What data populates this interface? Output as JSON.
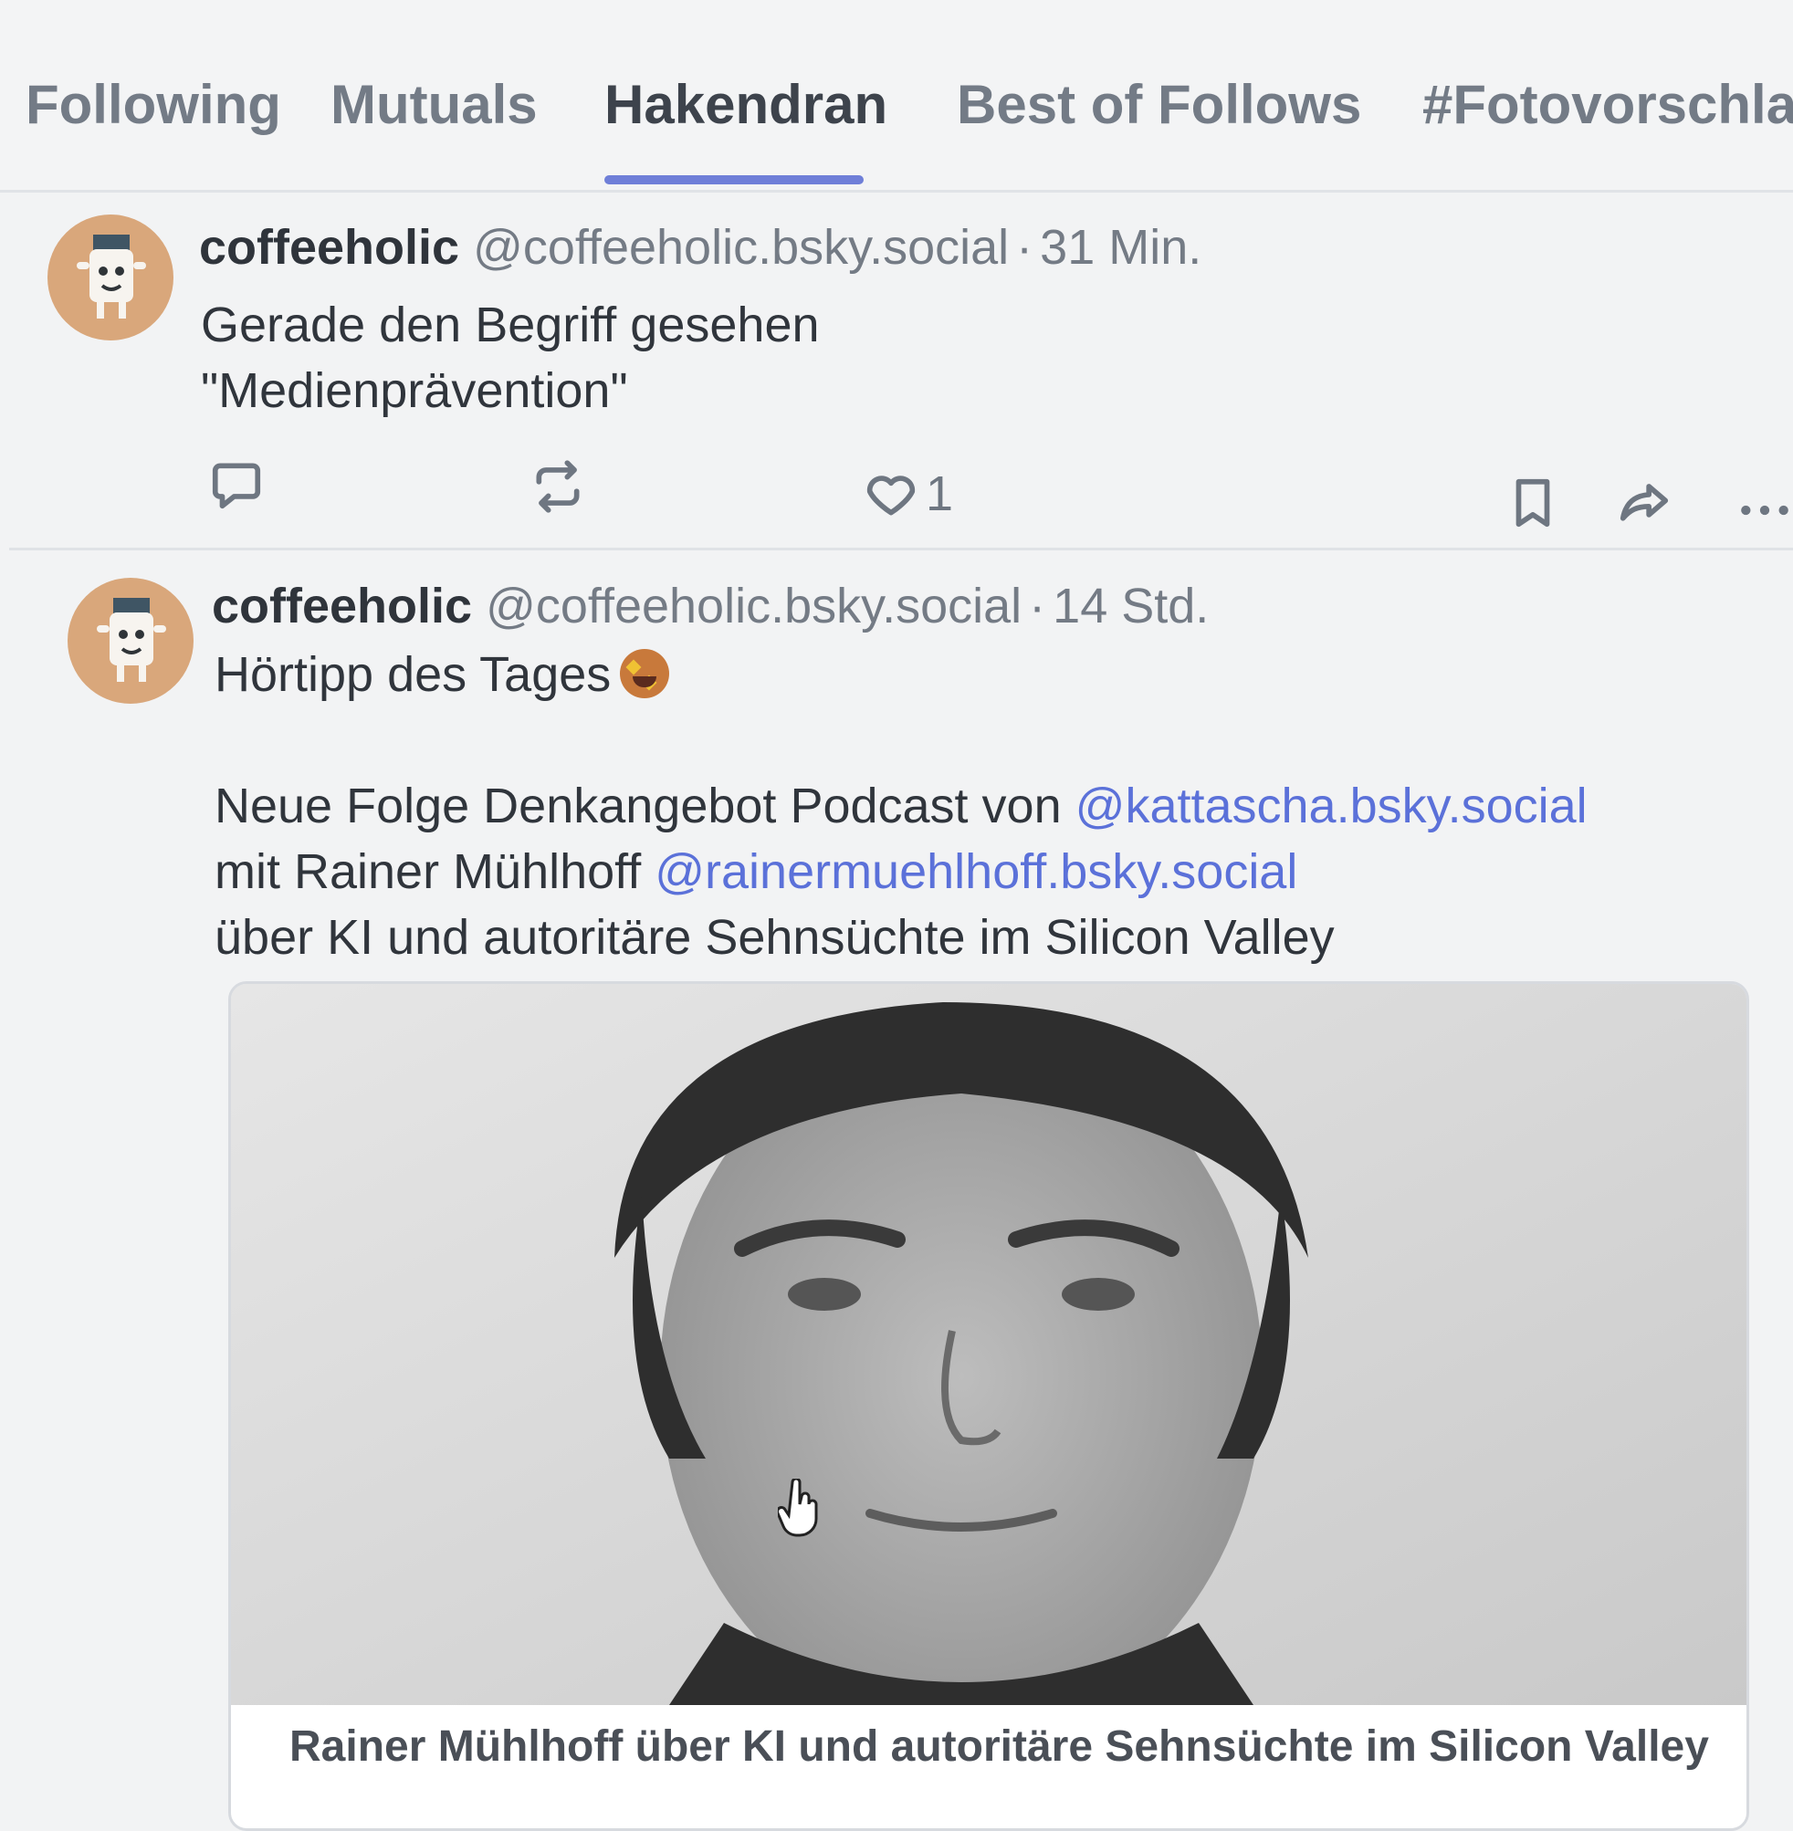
{
  "tabs": [
    {
      "label": "Following",
      "active": false
    },
    {
      "label": "Mutuals",
      "active": false
    },
    {
      "label": "Hakendran",
      "active": true
    },
    {
      "label": "Best of Follows",
      "active": false
    },
    {
      "label": "#Fotovorschla",
      "active": false
    }
  ],
  "posts": [
    {
      "display_name": "coffeeholic",
      "handle": "@coffeeholic.bsky.social",
      "separator": "·",
      "time": "31 Min.",
      "lines": [
        "Gerade den Begriff gesehen",
        "\"Medienprävention\""
      ],
      "like_count": "1"
    },
    {
      "display_name": "coffeeholic",
      "handle": "@coffeeholic.bsky.social",
      "separator": "·",
      "time": "14 Std.",
      "headline": "Hörtipp des Tages",
      "body_line1_prefix": "Neue Folge Denkangebot Podcast von ",
      "body_line1_mention": "@kattascha.bsky.social",
      "body_line2_prefix": "mit Rainer Mühlhoff ",
      "body_line2_mention": "@rainermuehlhoff.bsky.social",
      "body_line3": "über KI und autoritäre Sehnsüchte im Silicon Valley",
      "card_title": "Rainer Mühlhoff über KI und autoritäre Sehnsüchte im Silicon Valley"
    }
  ],
  "colors": {
    "accent": "#6f7fd8",
    "mention": "#5b71d9",
    "avatar_bg": "#d9a77b",
    "background": "#f2f3f4"
  },
  "icons": [
    "reply-icon",
    "repost-icon",
    "like-icon",
    "bookmark-icon",
    "share-icon",
    "more-icon"
  ]
}
